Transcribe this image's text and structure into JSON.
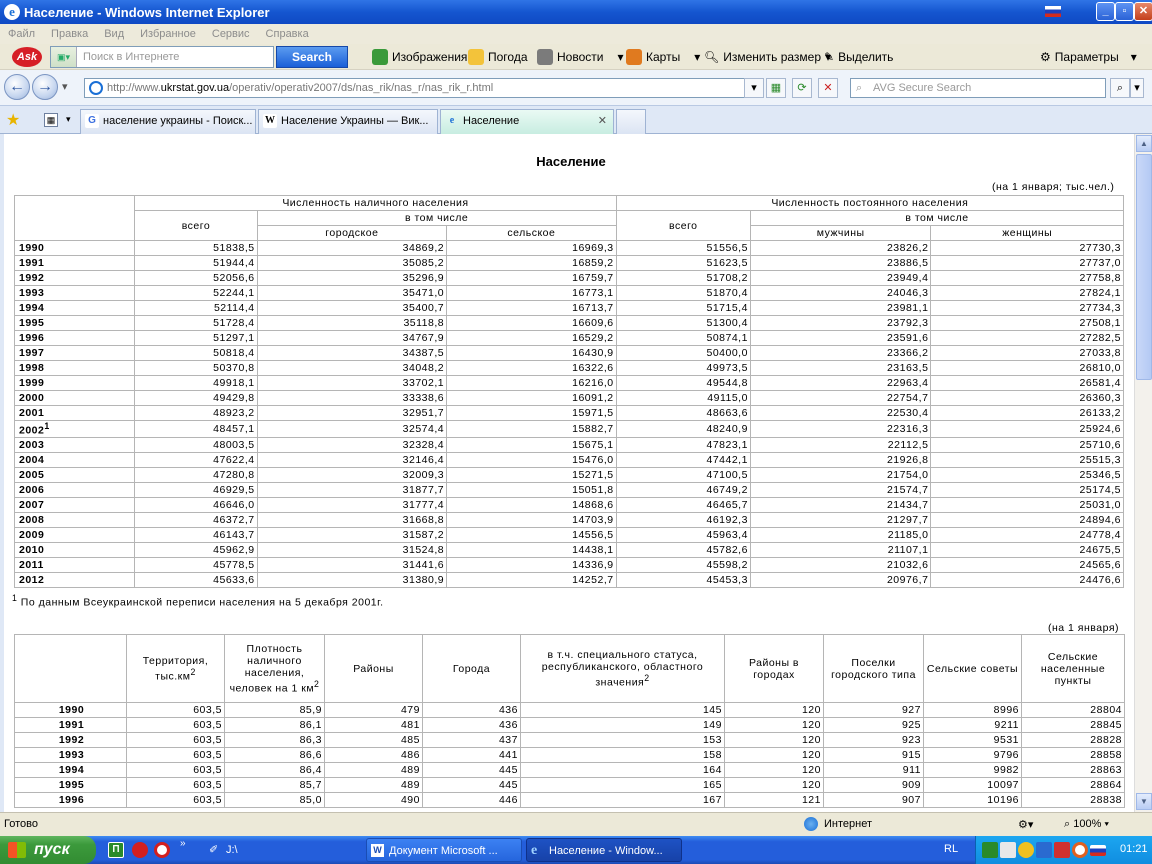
{
  "window": {
    "title": "Население - Windows Internet Explorer"
  },
  "menu": [
    "Файл",
    "Правка",
    "Вид",
    "Избранное",
    "Сервис",
    "Справка"
  ],
  "ask": {
    "placeholder": "Поиск в Интернете",
    "search": "Search",
    "images": "Изображения",
    "weather": "Погода",
    "news": "Новости",
    "maps": "Карты",
    "resize": "Изменить размер",
    "highlight": "Выделить",
    "params": "Параметры"
  },
  "address": {
    "prefix": "http://www.",
    "domain": "ukrstat.gov.ua",
    "path": "/operativ/operativ2007/ds/nas_rik/nas_r/nas_rik_r.html",
    "avg": "AVG Secure Search"
  },
  "tabs": [
    {
      "label": "население украины - Поиск...",
      "icon": "G"
    },
    {
      "label": "Население Украины — Вик...",
      "icon": "W"
    },
    {
      "label": "Население",
      "icon": "e"
    }
  ],
  "page": {
    "title": "Население",
    "note1": "(на 1 января; тыс.чел.)",
    "h_present": "Численность наличного населения",
    "h_permanent": "Численность постоянного населения",
    "h_total": "всего",
    "h_incl": "в том числе",
    "h_urban": "городское",
    "h_rural": "сельское",
    "h_men": "мужчины",
    "h_women": "женщины",
    "footnote": "По данным Всеукраинской переписи населения на 5 декабря 2001г.",
    "footnote_mark": "1",
    "note2": "(на 1 января)",
    "t2h": {
      "terr": "Территория, тыс.км",
      "terr_sup": "2",
      "dens": "Плотность наличного населения, человек на 1 км",
      "dens_sup": "2",
      "dist": "Районы",
      "cities": "Города",
      "special": "в т.ч. специального статуса, республиканского, областного значения",
      "special_sup": "2",
      "city_dist": "Районы в городах",
      "towns": "Поселки городского типа",
      "councils": "Сельские советы",
      "villages": "Сельские населенные пункты"
    }
  },
  "table1": [
    [
      "1990",
      "51838,5",
      "34869,2",
      "16969,3",
      "51556,5",
      "23826,2",
      "27730,3"
    ],
    [
      "1991",
      "51944,4",
      "35085,2",
      "16859,2",
      "51623,5",
      "23886,5",
      "27737,0"
    ],
    [
      "1992",
      "52056,6",
      "35296,9",
      "16759,7",
      "51708,2",
      "23949,4",
      "27758,8"
    ],
    [
      "1993",
      "52244,1",
      "35471,0",
      "16773,1",
      "51870,4",
      "24046,3",
      "27824,1"
    ],
    [
      "1994",
      "52114,4",
      "35400,7",
      "16713,7",
      "51715,4",
      "23981,1",
      "27734,3"
    ],
    [
      "1995",
      "51728,4",
      "35118,8",
      "16609,6",
      "51300,4",
      "23792,3",
      "27508,1"
    ],
    [
      "1996",
      "51297,1",
      "34767,9",
      "16529,2",
      "50874,1",
      "23591,6",
      "27282,5"
    ],
    [
      "1997",
      "50818,4",
      "34387,5",
      "16430,9",
      "50400,0",
      "23366,2",
      "27033,8"
    ],
    [
      "1998",
      "50370,8",
      "34048,2",
      "16322,6",
      "49973,5",
      "23163,5",
      "26810,0"
    ],
    [
      "1999",
      "49918,1",
      "33702,1",
      "16216,0",
      "49544,8",
      "22963,4",
      "26581,4"
    ],
    [
      "2000",
      "49429,8",
      "33338,6",
      "16091,2",
      "49115,0",
      "22754,7",
      "26360,3"
    ],
    [
      "2001",
      "48923,2",
      "32951,7",
      "15971,5",
      "48663,6",
      "22530,4",
      "26133,2"
    ],
    [
      "2002",
      "48457,1",
      "32574,4",
      "15882,7",
      "48240,9",
      "22316,3",
      "25924,6"
    ],
    [
      "2003",
      "48003,5",
      "32328,4",
      "15675,1",
      "47823,1",
      "22112,5",
      "25710,6"
    ],
    [
      "2004",
      "47622,4",
      "32146,4",
      "15476,0",
      "47442,1",
      "21926,8",
      "25515,3"
    ],
    [
      "2005",
      "47280,8",
      "32009,3",
      "15271,5",
      "47100,5",
      "21754,0",
      "25346,5"
    ],
    [
      "2006",
      "46929,5",
      "31877,7",
      "15051,8",
      "46749,2",
      "21574,7",
      "25174,5"
    ],
    [
      "2007",
      "46646,0",
      "31777,4",
      "14868,6",
      "46465,7",
      "21434,7",
      "25031,0"
    ],
    [
      "2008",
      "46372,7",
      "31668,8",
      "14703,9",
      "46192,3",
      "21297,7",
      "24894,6"
    ],
    [
      "2009",
      "46143,7",
      "31587,2",
      "14556,5",
      "45963,4",
      "21185,0",
      "24778,4"
    ],
    [
      "2010",
      "45962,9",
      "31524,8",
      "14438,1",
      "45782,6",
      "21107,1",
      "24675,5"
    ],
    [
      "2011",
      "45778,5",
      "31441,6",
      "14336,9",
      "45598,2",
      "21032,6",
      "24565,6"
    ],
    [
      "2012",
      "45633,6",
      "31380,9",
      "14252,7",
      "45453,3",
      "20976,7",
      "24476,6"
    ]
  ],
  "table2": [
    [
      "1990",
      "603,5",
      "85,9",
      "479",
      "436",
      "145",
      "120",
      "927",
      "8996",
      "28804"
    ],
    [
      "1991",
      "603,5",
      "86,1",
      "481",
      "436",
      "149",
      "120",
      "925",
      "9211",
      "28845"
    ],
    [
      "1992",
      "603,5",
      "86,3",
      "485",
      "437",
      "153",
      "120",
      "923",
      "9531",
      "28828"
    ],
    [
      "1993",
      "603,5",
      "86,6",
      "486",
      "441",
      "158",
      "120",
      "915",
      "9796",
      "28858"
    ],
    [
      "1994",
      "603,5",
      "86,4",
      "489",
      "445",
      "164",
      "120",
      "911",
      "9982",
      "28863"
    ],
    [
      "1995",
      "603,5",
      "85,7",
      "489",
      "445",
      "165",
      "120",
      "909",
      "10097",
      "28864"
    ],
    [
      "1996",
      "603,5",
      "85,0",
      "490",
      "446",
      "167",
      "121",
      "907",
      "10196",
      "28838"
    ]
  ],
  "status": {
    "text": "Готово",
    "zone": "Интернет",
    "zoom": "100%"
  },
  "taskbar": {
    "start": "пуск",
    "items": [
      "J:\\",
      "Документ Microsoft ...",
      "Население - Window..."
    ],
    "lang": "RL",
    "clock": "01:21"
  }
}
